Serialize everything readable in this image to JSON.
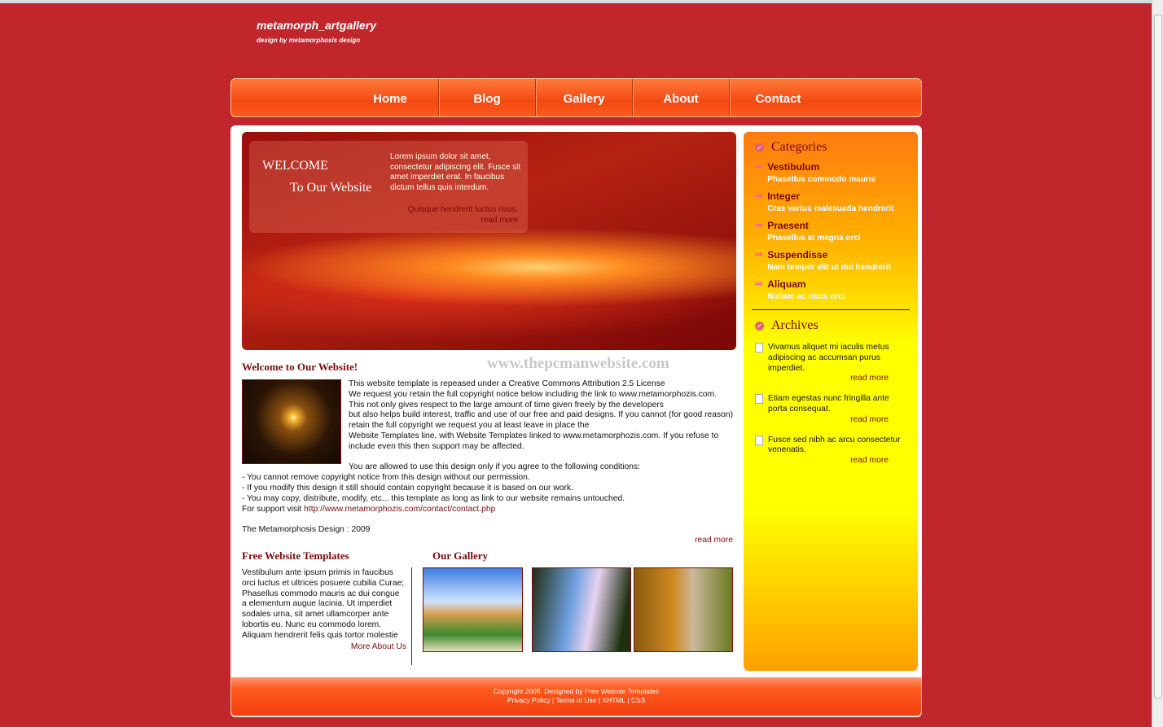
{
  "site": {
    "title": "metamorph_artgallery",
    "subtitle": "design by metamorphosis design"
  },
  "nav": [
    "Home",
    "Blog",
    "Gallery",
    "About",
    "Contact"
  ],
  "banner": {
    "welcome": "WELCOME",
    "to": "To Our Website",
    "text": "Lorem ipsum dolor sit amet, consectetur adipiscing elit. Fusce sit amet imperdiet erat. In faucibus dictum tellus quis interdum.",
    "quote": "Quisque hendrerit luctus risus.",
    "read_more": "read more"
  },
  "watermark": "www.thepcmanwebsite.com",
  "welcome": {
    "heading": "Welcome to Our Website!",
    "para1": [
      "This website template is repeased under a Creative Commons Attribution 2.5 License",
      "We request you retain the full copyright notice below including the link to www.metamorphozis.com.",
      "This not only gives respect to the large amount of time given freely by the developers",
      "but also helps build interest, traffic and use of our free and paid designs. If you cannot (for good reason) retain the full copyright we request you at least leave in place the",
      "Website Templates line, with Website Templates linked to www.metamorphozis.com. If you refuse to include even this then support may be affected."
    ],
    "conditions_intro": "You are allowed to use this design only if you agree to the following conditions:",
    "conditions": [
      "- You cannot remove copyright notice from this design without our permission.",
      "- If you modify this design it still should contain copyright because it is based on our work.",
      "- You may copy, distribute, modify, etc... this template as long as link to our website remains untouched."
    ],
    "support_label": "For support visit ",
    "support_link": "http://www.metamorphozis.com/contact/contact.php",
    "signature": "The Metamorphosis Design : 2009",
    "read_more": "read more"
  },
  "free": {
    "heading": "Free Website Templates",
    "text": "Vestibulum ante ipsum primis in faucibus orci luctus et ultrices posuere cubilia Curae; Phasellus commodo mauris ac dui congue a elementum augue lacinia. Ut imperdiet sodales urna, sit amet ullamcorper ante lobortis eu. Nunc eu commodo lorem. Aliquam hendrerit felis quis tortor molestie",
    "more": "More About Us"
  },
  "gallery": {
    "heading": "Our Gallery"
  },
  "sidebar": {
    "categories_title": "Categories",
    "categories": [
      {
        "t": "Vestibulum",
        "s": "Phasellus commodo mauris"
      },
      {
        "t": "Integer",
        "s": "Cras varius malesuada hendrerit"
      },
      {
        "t": "Praesent",
        "s": "Phasellus at magna orci"
      },
      {
        "t": "Suspendisse",
        "s": "Nam tempor elit ut dui hendrerit"
      },
      {
        "t": "Aliquam",
        "s": "Nullam ac risus orci"
      }
    ],
    "archives_title": "Archives",
    "archives": [
      {
        "t": "Vivamus aliquet mi iaculis metus adipiscing ac accumsan purus imperdiet.",
        "rm": "read more"
      },
      {
        "t": "Etiam egestas nunc fringilla ante porta consequat.",
        "rm": "read more"
      },
      {
        "t": "Fusce sed nibh ac arcu consectetur venenatis.",
        "rm": "read more"
      }
    ]
  },
  "footer": {
    "copyright": "Copyright 2009. Designed by Free Website Templates",
    "links": [
      "Privacy Policy",
      "Terms of Use",
      "XHTML",
      "CSS"
    ]
  }
}
